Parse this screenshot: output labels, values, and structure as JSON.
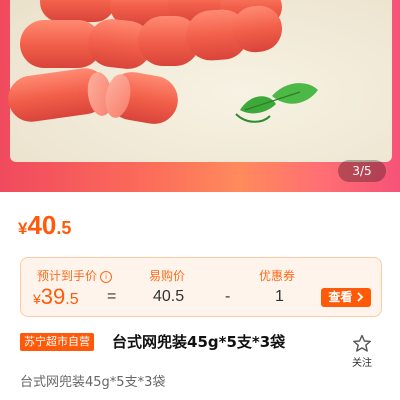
{
  "gallery": {
    "counter": "3/5"
  },
  "price": {
    "currency": "¥",
    "integer": "40",
    "decimal": ".5"
  },
  "estimate": {
    "estimated_label": "预计到手价",
    "estimated_value": {
      "currency": "¥",
      "integer": "39",
      "decimal": ".5"
    },
    "equals": "=",
    "easy_price_label": "易购价",
    "easy_price_value": "40.5",
    "minus": "-",
    "coupon_label": "优惠券",
    "coupon_value": "1",
    "view_button": "查看",
    "info_icon": "ⓘ"
  },
  "product": {
    "badge": "苏宁超市自营",
    "title": "台式网兜装45g*5支*3袋",
    "subtitle": "台式网兜装45g*5支*3袋",
    "follow_label": "关注"
  },
  "colors": {
    "accent": "#ff5a0a",
    "card_bg": "#fff4ec",
    "card_border": "#ffc9a6"
  }
}
